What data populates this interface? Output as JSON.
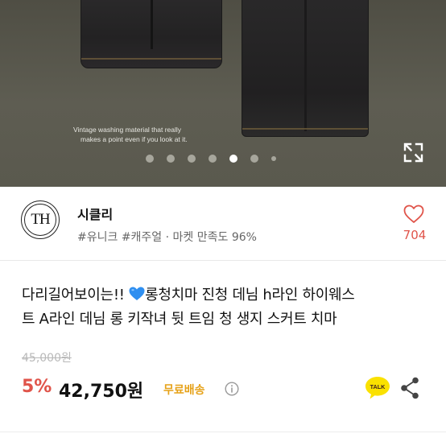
{
  "hero": {
    "caption_line1": "Vintage washing material that really",
    "caption_line2": "makes a point even if you look at it.",
    "dots_total": 7,
    "dots_active_index": 4
  },
  "seller": {
    "logo_text": "TH",
    "name": "시클리",
    "tags": "#유니크 #캐주얼 · 마켓 만족도 96%",
    "like_count": "704"
  },
  "product": {
    "title_line1_before": "다리길어보이는!! ",
    "title_line1_after": "롱청치마 진청 데님 h라인 하이웨스",
    "title_line2": "트 A라인 데님 롱 키작녀 뒷 트임 청 생지 스커트 치마",
    "original_price": "45,000원",
    "discount": "5%",
    "price": "42,750원",
    "shipping": "무료배송",
    "talk_label": "TALK"
  },
  "colors": {
    "accent_red": "#e0544a",
    "shipping_yellow": "#e6a21a",
    "talk_yellow": "#fae100"
  }
}
